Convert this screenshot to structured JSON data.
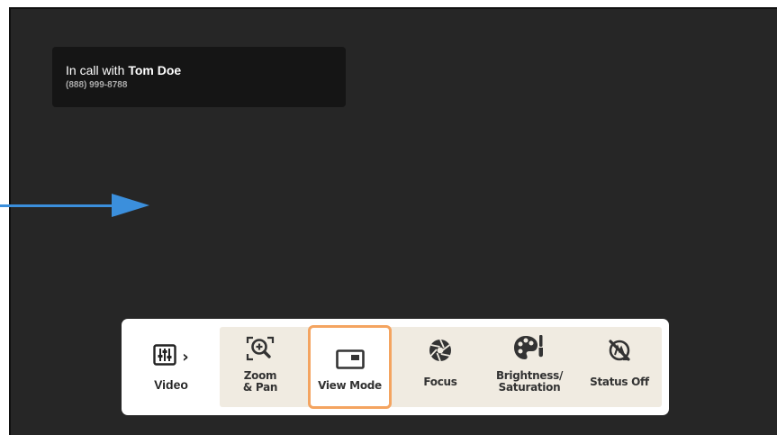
{
  "call": {
    "prefix": "In call with",
    "name": "Tom Doe",
    "number": "(888) 999-8788"
  },
  "toolbar": {
    "video_label": "Video",
    "chevron": "›",
    "items": [
      {
        "label": "Zoom\n& Pan",
        "icon": "zoom-pan-icon"
      },
      {
        "label": "View Mode",
        "icon": "view-mode-icon",
        "selected": true
      },
      {
        "label": "Focus",
        "icon": "aperture-icon"
      },
      {
        "label": "Brightness/\nSaturation",
        "icon": "palette-icon"
      },
      {
        "label": "Status Off",
        "icon": "status-off-icon"
      }
    ]
  },
  "colors": {
    "screen_bg": "#262626",
    "call_card_bg": "#151515",
    "tray_bg": "#f0ebe1",
    "selected_border": "#f4a460",
    "arrow": "#3b8fdc"
  }
}
